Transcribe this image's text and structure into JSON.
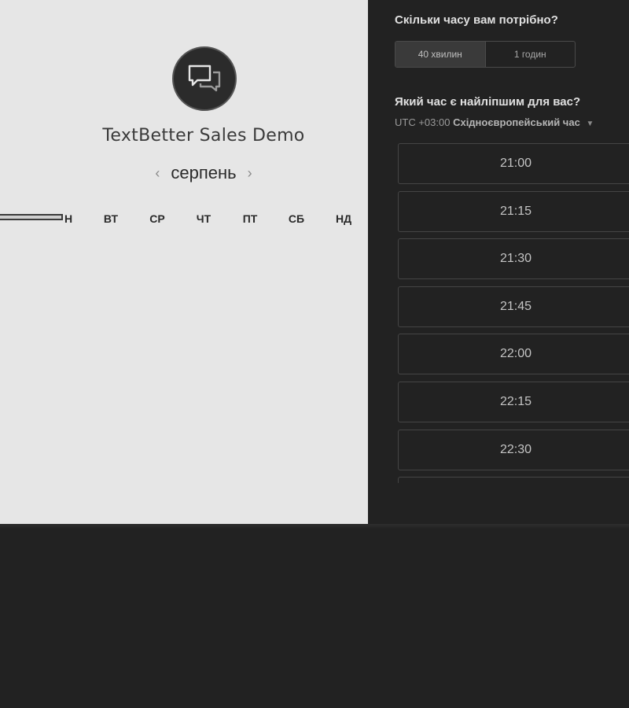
{
  "calendar": {
    "title": "TextBetter Sales Demo",
    "month": "серпень",
    "prev_icon": "chevron-left-icon",
    "next_icon": "chevron-right-icon",
    "weekdays": [
      "Н",
      "ВТ",
      "СР",
      "ЧТ",
      "ПТ",
      "СБ",
      "НД"
    ],
    "logo_icon": "chat-bubbles-icon"
  },
  "booking": {
    "duration_question": "Скільки часу вам потрібно?",
    "durations": [
      {
        "label": "40 хвилин",
        "selected": true
      },
      {
        "label": "1 годин",
        "selected": false
      }
    ],
    "time_question": "Який час є найліпшим для вас?",
    "timezone_prefix": "UTC +03:00",
    "timezone_name": "Східноєвропейський час",
    "timezone_icon": "caret-down-icon",
    "slots": [
      "21:00",
      "21:15",
      "21:30",
      "21:45",
      "22:00",
      "22:15",
      "22:30",
      ""
    ]
  }
}
